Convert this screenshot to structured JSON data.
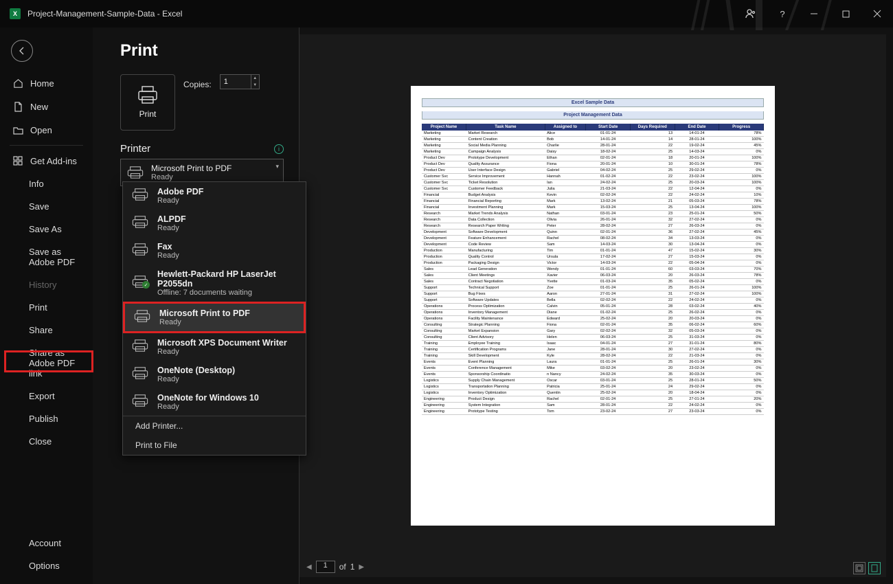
{
  "titlebar": {
    "title": "Project-Management-Sample-Data  -  Excel"
  },
  "sidebar": {
    "home": "Home",
    "new": "New",
    "open": "Open",
    "getaddins": "Get Add-ins",
    "info": "Info",
    "save": "Save",
    "saveas": "Save As",
    "saveadobe": "Save as Adobe PDF",
    "history": "History",
    "print": "Print",
    "share": "Share",
    "shareadobe": "Share as Adobe PDF link",
    "export": "Export",
    "publish": "Publish",
    "close": "Close",
    "account": "Account",
    "options": "Options"
  },
  "print": {
    "title": "Print",
    "printbtn": "Print",
    "copies_label": "Copies:",
    "copies_value": "1",
    "printer_label": "Printer",
    "selected_printer_name": "Microsoft Print to PDF",
    "selected_printer_status": "Ready"
  },
  "printer_dropdown": {
    "items": [
      {
        "name": "Adobe PDF",
        "status": "Ready"
      },
      {
        "name": "ALPDF",
        "status": "Ready"
      },
      {
        "name": "Fax",
        "status": "Ready"
      },
      {
        "name": "Hewlett-Packard HP LaserJet P2055dn",
        "status": "Offline: 7 documents waiting",
        "badge": "ok"
      },
      {
        "name": "Microsoft Print to PDF",
        "status": "Ready",
        "selected": true
      },
      {
        "name": "Microsoft XPS Document Writer",
        "status": "Ready"
      },
      {
        "name": "OneNote (Desktop)",
        "status": "Ready"
      },
      {
        "name": "OneNote for Windows 10",
        "status": "Ready"
      }
    ],
    "add_printer": "Add Printer...",
    "print_to_file": "Print to File"
  },
  "preview": {
    "title1": "Excel Sample Data",
    "title2": "Project Management Data",
    "headers": [
      "Project Name",
      "Task Name",
      "Assigned to",
      "Start Date",
      "Days Required",
      "End Date",
      "Progress"
    ],
    "rows": [
      [
        "Marketing",
        "Market Research",
        "Alice",
        "01-01-24",
        "13",
        "14-01-24",
        "78%"
      ],
      [
        "Marketing",
        "Content Creation",
        "Bob",
        "14-01-24",
        "14",
        "28-01-24",
        "100%"
      ],
      [
        "Marketing",
        "Social Media Planning",
        "Charlie",
        "28-01-24",
        "22",
        "19-02-24",
        "45%"
      ],
      [
        "Marketing",
        "Campaign Analysis",
        "Daisy",
        "18-02-24",
        "25",
        "14-03-24",
        "0%"
      ],
      [
        "Product Dev",
        "Prototype Development",
        "Ethan",
        "02-01-24",
        "18",
        "20-01-24",
        "100%"
      ],
      [
        "Product Dev",
        "Quality Assurance",
        "Fiona",
        "20-01-24",
        "10",
        "30-01-24",
        "78%"
      ],
      [
        "Product Dev",
        "User Interface Design",
        "Gabriel",
        "04-02-24",
        "25",
        "29-02-24",
        "0%"
      ],
      [
        "Customer Svc",
        "Service Improvement",
        "Hannah",
        "01-02-24",
        "22",
        "23-02-24",
        "100%"
      ],
      [
        "Customer Svc",
        "Ticket Resolution",
        "Ian",
        "24-02-24",
        "25",
        "20-03-24",
        "100%"
      ],
      [
        "Customer Svc",
        "Customer Feedback",
        "Julia",
        "21-03-24",
        "22",
        "12-04-24",
        "0%"
      ],
      [
        "Financial",
        "Budget Analysis",
        "Kevin",
        "02-02-24",
        "22",
        "24-02-24",
        "10%"
      ],
      [
        "Financial",
        "Financial Reporting",
        "Mark",
        "13-02-24",
        "21",
        "05-03-24",
        "78%"
      ],
      [
        "Financial",
        "Investment Planning",
        "Mark",
        "15-03-24",
        "25",
        "13-04-24",
        "100%"
      ],
      [
        "Research",
        "Market Trends Analysis",
        "Nathan",
        "03-01-24",
        "23",
        "25-01-24",
        "50%"
      ],
      [
        "Research",
        "Data Collection",
        "Olivia",
        "26-01-24",
        "32",
        "27-02-24",
        "0%"
      ],
      [
        "Research",
        "Research Paper Writing",
        "Peter",
        "28-02-24",
        "27",
        "26-03-24",
        "0%"
      ],
      [
        "Development",
        "Software Development",
        "Quinn",
        "02-01-24",
        "36",
        "27-02-24",
        "45%"
      ],
      [
        "Development",
        "Feature Enhancement",
        "Rachel",
        "08-02-24",
        "34",
        "13-03-24",
        "0%"
      ],
      [
        "Development",
        "Code Review",
        "Sam",
        "14-03-24",
        "30",
        "13-04-24",
        "0%"
      ],
      [
        "Production",
        "Manufacturing",
        "Tim",
        "01-01-24",
        "47",
        "15-02-24",
        "30%"
      ],
      [
        "Production",
        "Quality Control",
        "Ursula",
        "17-02-24",
        "27",
        "15-03-24",
        "0%"
      ],
      [
        "Production",
        "Packaging Design",
        "Victor",
        "14-03-24",
        "22",
        "05-04-24",
        "0%"
      ],
      [
        "Sales",
        "Lead Generation",
        "Wendy",
        "01-01-24",
        "60",
        "03-03-24",
        "70%"
      ],
      [
        "Sales",
        "Client Meetings",
        "Xavier",
        "06-03-24",
        "20",
        "26-03-24",
        "78%"
      ],
      [
        "Sales",
        "Contract Negotiation",
        "Yvette",
        "01-03-24",
        "35",
        "05-02-24",
        "0%"
      ],
      [
        "Support",
        "Technical Support",
        "Zoe",
        "01-01-24",
        "25",
        "26-01-24",
        "100%"
      ],
      [
        "Support",
        "Bug Fixes",
        "Aaron",
        "27-01-24",
        "31",
        "27-02-24",
        "100%"
      ],
      [
        "Support",
        "Software Updates",
        "Bella",
        "02-02-24",
        "22",
        "24-02-24",
        "0%"
      ],
      [
        "Operations",
        "Process Optimization",
        "Calvin",
        "05-01-24",
        "28",
        "03-02-24",
        "40%"
      ],
      [
        "Operations",
        "Inventory Management",
        "Diane",
        "01-02-24",
        "25",
        "26-02-24",
        "0%"
      ],
      [
        "Operations",
        "Facility Maintenance",
        "Edward",
        "25-02-24",
        "20",
        "20-03-24",
        "0%"
      ],
      [
        "Consulting",
        "Strategic Planning",
        "Fiona",
        "02-01-24",
        "35",
        "06-02-24",
        "60%"
      ],
      [
        "Consulting",
        "Market Expansion",
        "Gary",
        "02-02-24",
        "32",
        "05-03-24",
        "0%"
      ],
      [
        "Consulting",
        "Client Advisory",
        "Helen",
        "06-03-24",
        "25",
        "31-03-24",
        "0%"
      ],
      [
        "Training",
        "Employee Training",
        "Isaac",
        "04-01-24",
        "27",
        "31-01-24",
        "80%"
      ],
      [
        "Training",
        "Certification Programs",
        "Jane",
        "28-01-24",
        "30",
        "27-02-24",
        "0%"
      ],
      [
        "Training",
        "Skill Development",
        "Kyle",
        "28-02-24",
        "22",
        "21-03-24",
        "0%"
      ],
      [
        "Events",
        "Event Planning",
        "Laura",
        "01-01-24",
        "25",
        "26-01-24",
        "30%"
      ],
      [
        "Events",
        "Conference Management",
        "Mike",
        "03-02-24",
        "20",
        "23-02-24",
        "0%"
      ],
      [
        "Events",
        "Sponsorship Coordinatio",
        "n Nancy",
        "24-02-24",
        "35",
        "30-03-24",
        "0%"
      ],
      [
        "Logistics",
        "Supply Chain Management",
        "Oscar",
        "03-01-24",
        "25",
        "28-01-24",
        "50%"
      ],
      [
        "Logistics",
        "Transportation Planning",
        "Patricia",
        "25-01-24",
        "24",
        "29-02-24",
        "0%"
      ],
      [
        "Logistics",
        "Inventory Optimization",
        "Quentin",
        "25-02-24",
        "20",
        "18-04-24",
        "0%"
      ],
      [
        "Engineering",
        "Product Design",
        "Rachel",
        "02-01-24",
        "25",
        "27-01-24",
        "20%"
      ],
      [
        "Engineering",
        "System Integration",
        "Sam",
        "28-01-24",
        "22",
        "24-02-24",
        "0%"
      ],
      [
        "Engineering",
        "Prototype Testing",
        "Tom",
        "23-02-24",
        "27",
        "23-03-24",
        "0%"
      ]
    ]
  },
  "pager": {
    "page": "1",
    "of_label": "of",
    "total": "1"
  }
}
